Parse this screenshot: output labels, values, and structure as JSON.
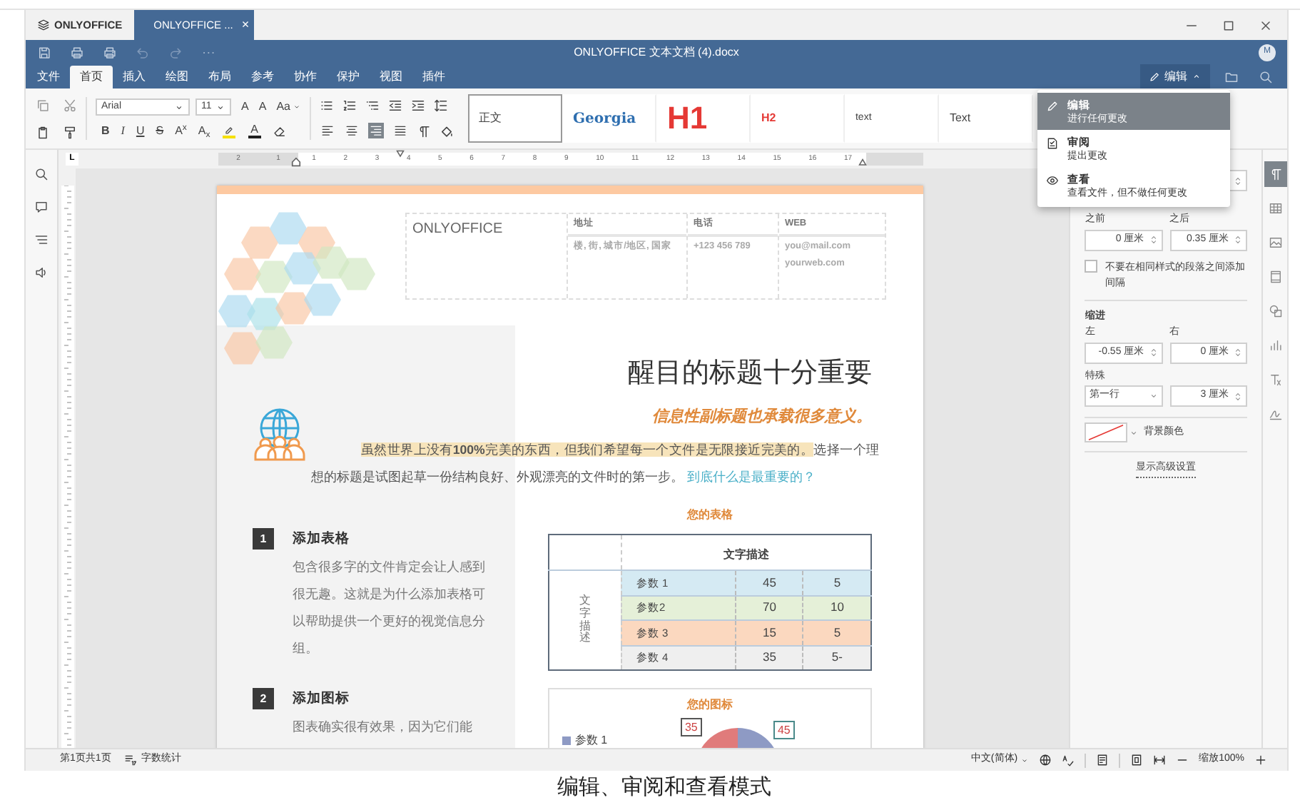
{
  "tab_bar": {
    "app_label": "ONLYOFFICE",
    "tabs": [
      {
        "label": "ONLYOFFICE ...",
        "close": "×",
        "selected": true
      }
    ]
  },
  "header": {
    "title": "ONLYOFFICE 文本文档 (4).docx",
    "avatar": "M",
    "mode_button": "编辑"
  },
  "menu": [
    {
      "label": "文件",
      "selected": false
    },
    {
      "label": "首页",
      "selected": true
    },
    {
      "label": "插入",
      "selected": false
    },
    {
      "label": "绘图",
      "selected": false
    },
    {
      "label": "布局",
      "selected": false
    },
    {
      "label": "参考",
      "selected": false
    },
    {
      "label": "协作",
      "selected": false
    },
    {
      "label": "保护",
      "selected": false
    },
    {
      "label": "视图",
      "selected": false
    },
    {
      "label": "插件",
      "selected": false
    }
  ],
  "toolbar": {
    "font": "Arial",
    "size": "11",
    "size_buttons": [
      "A",
      "A",
      "Aa"
    ],
    "format_buttons": [
      "B",
      "I",
      "U",
      "S",
      "A$^{x}$",
      "A$_{x}$"
    ],
    "font_color": "A",
    "align": [
      {
        "selected": false
      },
      {
        "selected": false
      },
      {
        "selected": true
      },
      {
        "selected": false
      }
    ],
    "styles": [
      {
        "label": "正文",
        "selected": true
      },
      {
        "label": "Georgia",
        "selected": false
      },
      {
        "label": "H1",
        "selected": false
      },
      {
        "label": "H2",
        "selected": false
      },
      {
        "label": "text",
        "selected": false
      },
      {
        "label": "Text",
        "selected": false
      }
    ]
  },
  "ruler": {
    "tab_stop": "L",
    "left_numbers": [
      "2",
      "1"
    ],
    "numbers": [
      "1",
      "2",
      "3",
      "4",
      "5",
      "6",
      "7",
      "8",
      "9",
      "10",
      "11",
      "12",
      "13",
      "14",
      "15",
      "16",
      "17"
    ]
  },
  "document": {
    "company": "ONLYOFFICE",
    "contacts": [
      {
        "label": "地址",
        "lines": [
          "楼, 街, 城市/地区, 国家"
        ]
      },
      {
        "label": "电话",
        "lines": [
          "+123 456 789"
        ]
      },
      {
        "label": "WEB",
        "lines": [
          "you@mail.com",
          "yourweb.com"
        ]
      }
    ],
    "title": "醒目的标题十分重要",
    "subtitle": "信息性副标题也承载很多意义。",
    "paragraph": {
      "highlighted": "虽然世界上没有**100%**完美的东西，但我们希望每一个文件是无限接近完美的。",
      "text": "选择一个理想的标题是试图起草一份结构良好、外观漂亮的文件时的第一步。",
      "link": "到底什么是最重要的？"
    },
    "sections": [
      {
        "number": "1",
        "heading": "添加表格",
        "body": "包含很多字的文件肯定会让人感到很无趣。这就是为什么添加表格可以帮助提供一个更好的视觉信息分组。"
      },
      {
        "number": "2",
        "heading": "添加图标",
        "body": "图表确实很有效果，因为它们能"
      }
    ],
    "table": {
      "title": "您的表格",
      "header": "文字描述",
      "row_header": "文字描述",
      "rows": [
        {
          "cells": [
            "参数 1",
            "45",
            "5"
          ],
          "color": "#d5eaf3"
        },
        {
          "cells": [
            "参数2",
            "70",
            "10"
          ],
          "color": "#e5f0d8"
        },
        {
          "cells": [
            "参数 3",
            "15",
            "5"
          ],
          "color": "#fbd8bf"
        },
        {
          "cells": [
            "参数 4",
            "35",
            "5-"
          ],
          "color": "#efefef"
        }
      ]
    },
    "chart": {
      "title": "您的图标",
      "data_labels": [
        "35",
        "45"
      ],
      "legend": [
        "参数 1"
      ]
    }
  },
  "paragraph_settings": {
    "before_label": "之前",
    "after_label": "之后",
    "before": "0 厘米",
    "after": "0.35 厘米",
    "checkbox": {
      "label": "不要在相同样式的段落之间添加间隔",
      "checked": false
    },
    "indent_title": "缩进",
    "left_label": "左",
    "right_label": "右",
    "left": "-0.55 厘米",
    "right": "0 厘米",
    "special_label": "特殊",
    "special": "第一行",
    "special_value": "3 厘米",
    "background_label": "背景颜色",
    "advanced_link": "显示高级设置"
  },
  "right_tabs": [
    {
      "selected": true
    },
    {
      "selected": false
    },
    {
      "selected": false
    },
    {
      "selected": false
    },
    {
      "selected": false
    },
    {
      "selected": false
    },
    {
      "selected": false
    },
    {
      "selected": false
    }
  ],
  "mode_menu": [
    {
      "title": "编辑",
      "description": "进行任何更改",
      "selected": true
    },
    {
      "title": "审阅",
      "description": "提出更改",
      "selected": false
    },
    {
      "title": "查看",
      "description": "查看文件，但不做任何更改",
      "selected": false
    }
  ],
  "status_bar": {
    "page": "第1页共1页",
    "word_count": "字数统计",
    "language": "中文(简体)",
    "zoom": "缩放100%"
  },
  "caption": "编辑、审阅和查看模式"
}
